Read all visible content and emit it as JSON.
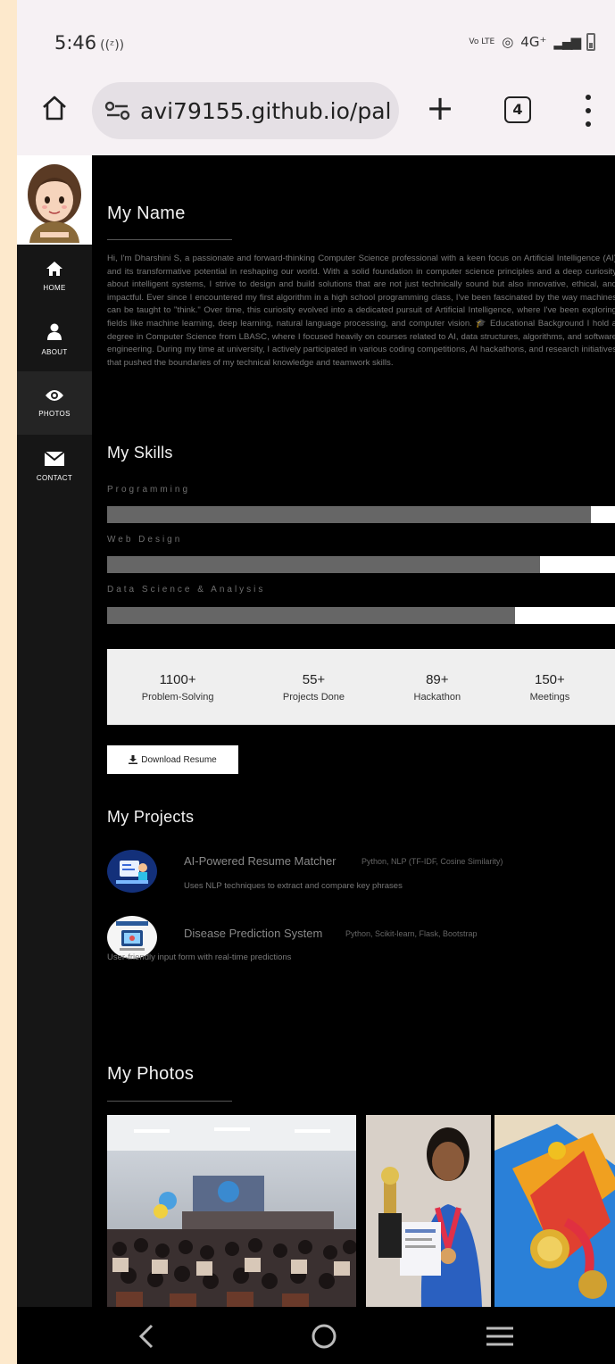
{
  "status": {
    "time": "5:46",
    "cast": "((ᶻ))",
    "network": "4G⁺",
    "volte": "Vo LTE"
  },
  "browser": {
    "url": "avi79155.github.io/pal",
    "tab_count": "4"
  },
  "sidebar": {
    "items": [
      {
        "label": "HOME",
        "icon": "home-icon"
      },
      {
        "label": "ABOUT",
        "icon": "user-icon"
      },
      {
        "label": "PHOTOS",
        "icon": "eye-icon"
      },
      {
        "label": "CONTACT",
        "icon": "mail-icon"
      }
    ]
  },
  "about": {
    "title": "My Name",
    "text": "Hi, I'm Dharshini S, a passionate and forward-thinking Computer Science professional with a keen focus on Artificial Intelligence (AI) and its transformative potential in reshaping our world. With a solid foundation in computer science principles and a deep curiosity about intelligent systems, I strive to design and build solutions that are not just technically sound but also innovative, ethical, and impactful. Ever since I encountered my first algorithm in a high school programming class, I've been fascinated by the way machines can be taught to \"think.\" Over time, this curiosity evolved into a dedicated pursuit of Artificial Intelligence, where I've been exploring fields like machine learning, deep learning, natural language processing, and computer vision. 🎓 Educational Background I hold a degree in Computer Science from LBASC, where I focused heavily on courses related to AI, data structures, algorithms, and software engineering. During my time at university, I actively participated in various coding competitions, AI hackathons, and research initiatives that pushed the boundaries of my technical knowledge and teamwork skills."
  },
  "skills": {
    "title": "My Skills",
    "items": [
      {
        "label": "Programming",
        "level": 0.95
      },
      {
        "label": "Web Design",
        "level": 0.85
      },
      {
        "label": "Data Science & Analysis",
        "level": 0.8
      }
    ]
  },
  "stats": [
    {
      "value": "1100+",
      "label": "Problem-Solving"
    },
    {
      "value": "55+",
      "label": "Projects Done"
    },
    {
      "value": "89+",
      "label": "Hackathon"
    },
    {
      "value": "150+",
      "label": "Meetings"
    }
  ],
  "resume": {
    "label": "Download Resume"
  },
  "projects": {
    "title": "My Projects",
    "items": [
      {
        "title": "AI-Powered Resume Matcher",
        "tech": "Python, NLP (TF-IDF, Cosine Similarity)",
        "desc": "Uses NLP techniques to extract and compare key phrases"
      },
      {
        "title": "Disease Prediction System",
        "tech": "Python, Scikit-learn, Flask, Bootstrap",
        "desc": "User-friendly input form with real-time predictions"
      }
    ]
  },
  "photos": {
    "title": "My Photos"
  }
}
